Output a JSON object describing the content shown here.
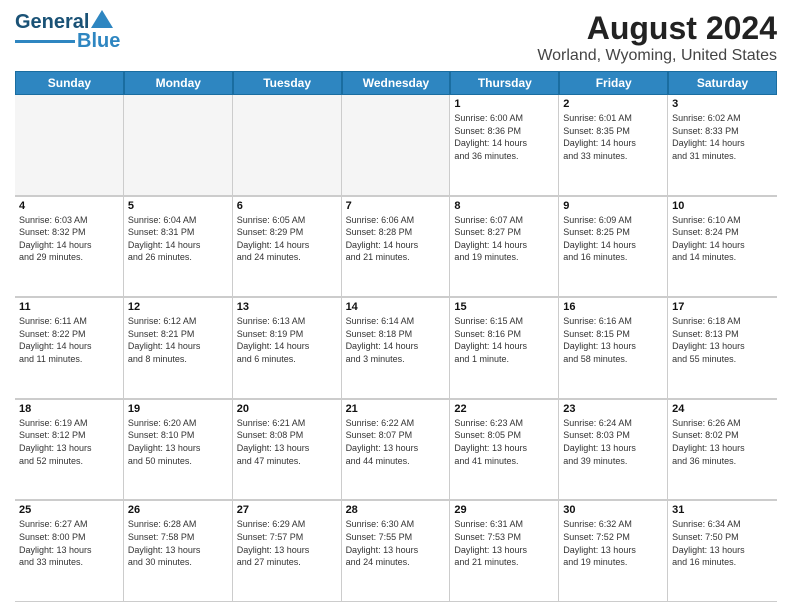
{
  "logo": {
    "text1": "General",
    "text2": "Blue"
  },
  "title": "August 2024",
  "subtitle": "Worland, Wyoming, United States",
  "days": [
    "Sunday",
    "Monday",
    "Tuesday",
    "Wednesday",
    "Thursday",
    "Friday",
    "Saturday"
  ],
  "weeks": [
    [
      {
        "day": "",
        "info": "",
        "empty": true
      },
      {
        "day": "",
        "info": "",
        "empty": true
      },
      {
        "day": "",
        "info": "",
        "empty": true
      },
      {
        "day": "",
        "info": "",
        "empty": true
      },
      {
        "day": "1",
        "info": "Sunrise: 6:00 AM\nSunset: 8:36 PM\nDaylight: 14 hours\nand 36 minutes."
      },
      {
        "day": "2",
        "info": "Sunrise: 6:01 AM\nSunset: 8:35 PM\nDaylight: 14 hours\nand 33 minutes."
      },
      {
        "day": "3",
        "info": "Sunrise: 6:02 AM\nSunset: 8:33 PM\nDaylight: 14 hours\nand 31 minutes."
      }
    ],
    [
      {
        "day": "4",
        "info": "Sunrise: 6:03 AM\nSunset: 8:32 PM\nDaylight: 14 hours\nand 29 minutes."
      },
      {
        "day": "5",
        "info": "Sunrise: 6:04 AM\nSunset: 8:31 PM\nDaylight: 14 hours\nand 26 minutes."
      },
      {
        "day": "6",
        "info": "Sunrise: 6:05 AM\nSunset: 8:29 PM\nDaylight: 14 hours\nand 24 minutes."
      },
      {
        "day": "7",
        "info": "Sunrise: 6:06 AM\nSunset: 8:28 PM\nDaylight: 14 hours\nand 21 minutes."
      },
      {
        "day": "8",
        "info": "Sunrise: 6:07 AM\nSunset: 8:27 PM\nDaylight: 14 hours\nand 19 minutes."
      },
      {
        "day": "9",
        "info": "Sunrise: 6:09 AM\nSunset: 8:25 PM\nDaylight: 14 hours\nand 16 minutes."
      },
      {
        "day": "10",
        "info": "Sunrise: 6:10 AM\nSunset: 8:24 PM\nDaylight: 14 hours\nand 14 minutes."
      }
    ],
    [
      {
        "day": "11",
        "info": "Sunrise: 6:11 AM\nSunset: 8:22 PM\nDaylight: 14 hours\nand 11 minutes."
      },
      {
        "day": "12",
        "info": "Sunrise: 6:12 AM\nSunset: 8:21 PM\nDaylight: 14 hours\nand 8 minutes."
      },
      {
        "day": "13",
        "info": "Sunrise: 6:13 AM\nSunset: 8:19 PM\nDaylight: 14 hours\nand 6 minutes."
      },
      {
        "day": "14",
        "info": "Sunrise: 6:14 AM\nSunset: 8:18 PM\nDaylight: 14 hours\nand 3 minutes."
      },
      {
        "day": "15",
        "info": "Sunrise: 6:15 AM\nSunset: 8:16 PM\nDaylight: 14 hours\nand 1 minute."
      },
      {
        "day": "16",
        "info": "Sunrise: 6:16 AM\nSunset: 8:15 PM\nDaylight: 13 hours\nand 58 minutes."
      },
      {
        "day": "17",
        "info": "Sunrise: 6:18 AM\nSunset: 8:13 PM\nDaylight: 13 hours\nand 55 minutes."
      }
    ],
    [
      {
        "day": "18",
        "info": "Sunrise: 6:19 AM\nSunset: 8:12 PM\nDaylight: 13 hours\nand 52 minutes."
      },
      {
        "day": "19",
        "info": "Sunrise: 6:20 AM\nSunset: 8:10 PM\nDaylight: 13 hours\nand 50 minutes."
      },
      {
        "day": "20",
        "info": "Sunrise: 6:21 AM\nSunset: 8:08 PM\nDaylight: 13 hours\nand 47 minutes."
      },
      {
        "day": "21",
        "info": "Sunrise: 6:22 AM\nSunset: 8:07 PM\nDaylight: 13 hours\nand 44 minutes."
      },
      {
        "day": "22",
        "info": "Sunrise: 6:23 AM\nSunset: 8:05 PM\nDaylight: 13 hours\nand 41 minutes."
      },
      {
        "day": "23",
        "info": "Sunrise: 6:24 AM\nSunset: 8:03 PM\nDaylight: 13 hours\nand 39 minutes."
      },
      {
        "day": "24",
        "info": "Sunrise: 6:26 AM\nSunset: 8:02 PM\nDaylight: 13 hours\nand 36 minutes."
      }
    ],
    [
      {
        "day": "25",
        "info": "Sunrise: 6:27 AM\nSunset: 8:00 PM\nDaylight: 13 hours\nand 33 minutes."
      },
      {
        "day": "26",
        "info": "Sunrise: 6:28 AM\nSunset: 7:58 PM\nDaylight: 13 hours\nand 30 minutes."
      },
      {
        "day": "27",
        "info": "Sunrise: 6:29 AM\nSunset: 7:57 PM\nDaylight: 13 hours\nand 27 minutes."
      },
      {
        "day": "28",
        "info": "Sunrise: 6:30 AM\nSunset: 7:55 PM\nDaylight: 13 hours\nand 24 minutes."
      },
      {
        "day": "29",
        "info": "Sunrise: 6:31 AM\nSunset: 7:53 PM\nDaylight: 13 hours\nand 21 minutes."
      },
      {
        "day": "30",
        "info": "Sunrise: 6:32 AM\nSunset: 7:52 PM\nDaylight: 13 hours\nand 19 minutes."
      },
      {
        "day": "31",
        "info": "Sunrise: 6:34 AM\nSunset: 7:50 PM\nDaylight: 13 hours\nand 16 minutes."
      }
    ]
  ]
}
